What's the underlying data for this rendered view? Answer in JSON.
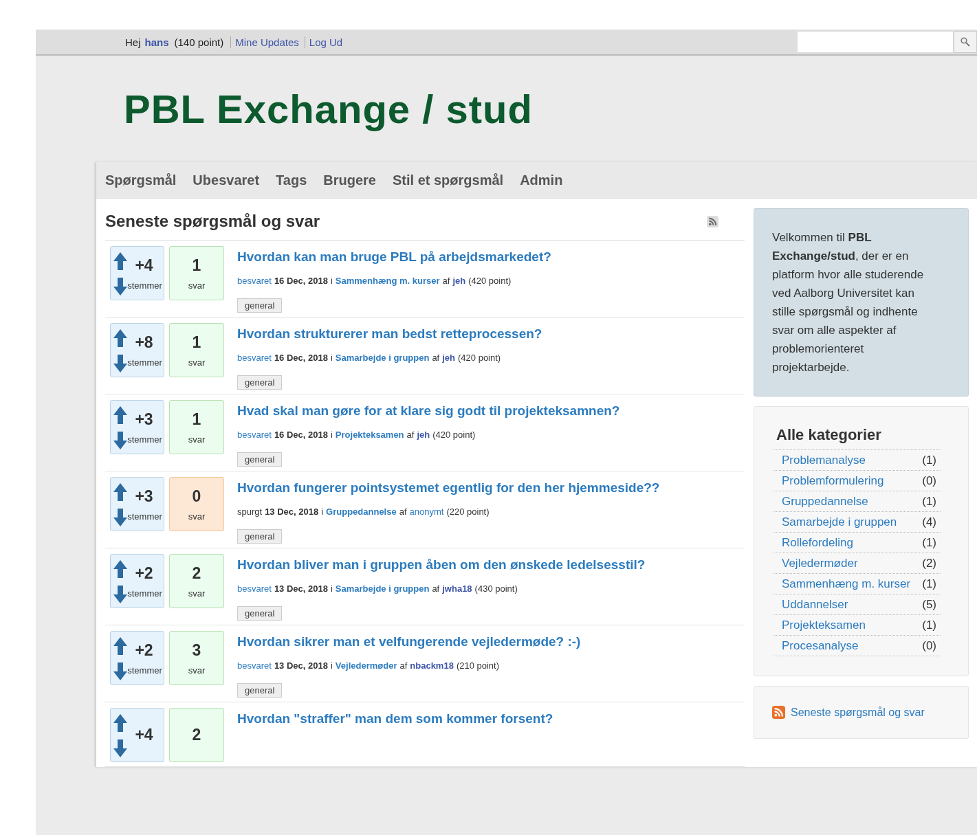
{
  "top_bar": {
    "greeting": "Hej",
    "user": "hans",
    "points": "(140 point)",
    "links": [
      "Mine Updates",
      "Log Ud"
    ]
  },
  "logo": "PBL Exchange / stud",
  "nav": [
    "Spørgsmål",
    "Ubesvaret",
    "Tags",
    "Brugere",
    "Stil et spørgsmål",
    "Admin"
  ],
  "main": {
    "heading": "Seneste spørgsmål og svar",
    "questions": [
      {
        "votes": "+4",
        "votes_label": "stemmer",
        "answers": "1",
        "answers_label": "svar",
        "answered": true,
        "title": "Hvordan kan man bruge PBL på arbejdsmarkedet?",
        "meta": {
          "action": "besvaret",
          "action_link": true,
          "date": "16 Dec, 2018",
          "in": "i",
          "category": "Sammenhæng m. kurser",
          "by": "af",
          "user": "jeh",
          "registered": true,
          "points": "(420 point)"
        },
        "tag": "general"
      },
      {
        "votes": "+8",
        "votes_label": "stemmer",
        "answers": "1",
        "answers_label": "svar",
        "answered": true,
        "title": "Hvordan strukturerer man bedst retteprocessen?",
        "meta": {
          "action": "besvaret",
          "action_link": true,
          "date": "16 Dec, 2018",
          "in": "i",
          "category": "Samarbejde i gruppen",
          "by": "af",
          "user": "jeh",
          "registered": true,
          "points": "(420 point)"
        },
        "tag": "general"
      },
      {
        "votes": "+3",
        "votes_label": "stemmer",
        "answers": "1",
        "answers_label": "svar",
        "answered": true,
        "title": "Hvad skal man gøre for at klare sig godt til projekteksamnen?",
        "meta": {
          "action": "besvaret",
          "action_link": true,
          "date": "16 Dec, 2018",
          "in": "i",
          "category": "Projekteksamen",
          "by": "af",
          "user": "jeh",
          "registered": true,
          "points": "(420 point)"
        },
        "tag": "general"
      },
      {
        "votes": "+3",
        "votes_label": "stemmer",
        "answers": "0",
        "answers_label": "svar",
        "answered": false,
        "title": "Hvordan fungerer pointsystemet egentlig for den her hjemmeside??",
        "meta": {
          "action": "spurgt",
          "action_link": false,
          "date": "13 Dec, 2018",
          "in": "i",
          "category": "Gruppedannelse",
          "by": "af",
          "user": "anonymt",
          "registered": false,
          "points": "(220 point)"
        },
        "tag": "general"
      },
      {
        "votes": "+2",
        "votes_label": "stemmer",
        "answers": "2",
        "answers_label": "svar",
        "answered": true,
        "title": "Hvordan bliver man i gruppen åben om den ønskede ledelsesstil?",
        "meta": {
          "action": "besvaret",
          "action_link": true,
          "date": "13 Dec, 2018",
          "in": "i",
          "category": "Samarbejde i gruppen",
          "by": "af",
          "user": "jwha18",
          "registered": true,
          "points": "(430 point)"
        },
        "tag": "general"
      },
      {
        "votes": "+2",
        "votes_label": "stemmer",
        "answers": "3",
        "answers_label": "svar",
        "answered": true,
        "title": "Hvordan sikrer man et velfungerende vejledermøde? :-)",
        "meta": {
          "action": "besvaret",
          "action_link": true,
          "date": "13 Dec, 2018",
          "in": "i",
          "category": "Vejledermøder",
          "by": "af",
          "user": "nbackm18",
          "registered": true,
          "points": "(210 point)"
        },
        "tag": "general"
      },
      {
        "votes": "+4",
        "answers": "2",
        "answered": true,
        "title": "Hvordan \"straffer\" man dem som kommer forsent?"
      }
    ]
  },
  "sidebar": {
    "welcome": "Velkommen til **PBL Exchange/stud**, der er en platform hvor alle studerende ved Aalborg Universitet kan stille spørgsmål og indhente svar om alle aspekter af problemorienteret projektarbejde.",
    "categories_title": "Alle kategorier",
    "categories": [
      {
        "name": "Problemanalyse",
        "count": "(1)"
      },
      {
        "name": "Problemformulering",
        "count": "(0)"
      },
      {
        "name": "Gruppedannelse",
        "count": "(1)"
      },
      {
        "name": "Samarbejde i gruppen",
        "count": "(4)"
      },
      {
        "name": "Rollefordeling",
        "count": "(1)"
      },
      {
        "name": "Vejledermøder",
        "count": "(2)"
      },
      {
        "name": "Sammenhæng m. kurser",
        "count": "(1)"
      },
      {
        "name": "Uddannelser",
        "count": "(5)"
      },
      {
        "name": "Projekteksamen",
        "count": "(1)"
      },
      {
        "name": "Procesanalyse",
        "count": "(0)"
      }
    ],
    "feed_link": "Seneste spørgsmål og svar"
  }
}
